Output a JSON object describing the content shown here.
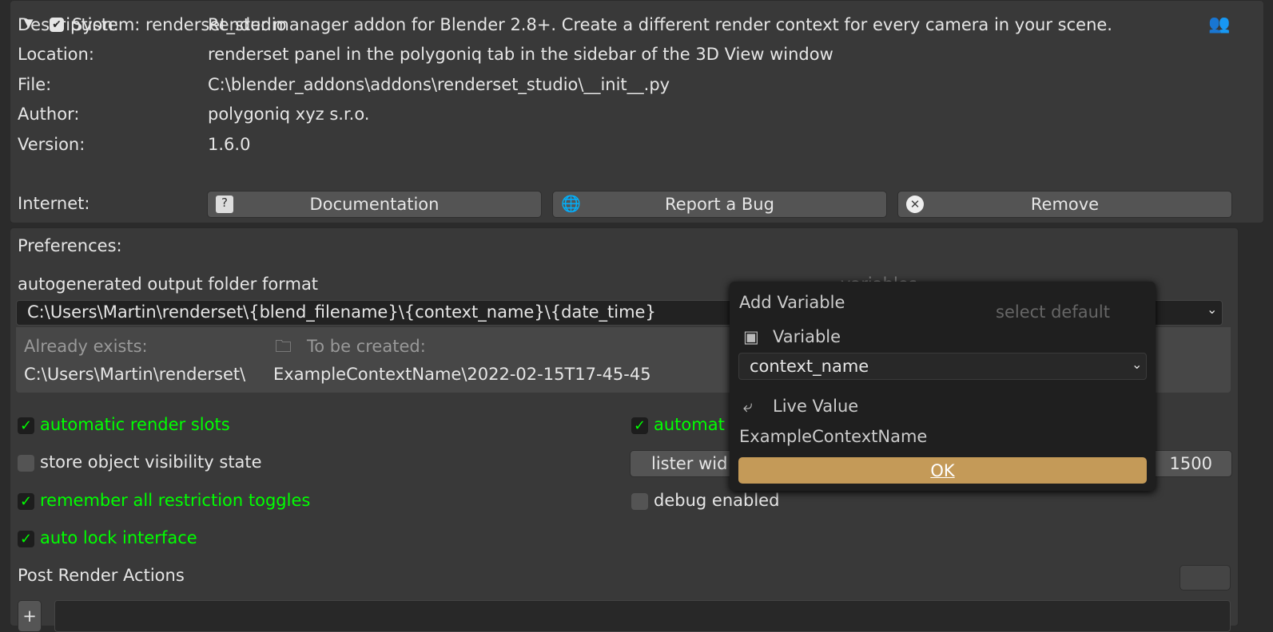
{
  "addon": {
    "title": "System: renderset_studio",
    "enabled": true,
    "rows": [
      {
        "label": "Description:",
        "value": "Render manager addon for Blender 2.8+. Create a different render context for every camera in your scene."
      },
      {
        "label": "Location:",
        "value": "renderset panel in the polygoniq tab in the sidebar of the 3D View window"
      },
      {
        "label": "File:",
        "value": "C:\\blender_addons\\addons\\renderset_studio\\__init__.py"
      },
      {
        "label": "Author:",
        "value": "polygoniq xyz s.r.o."
      },
      {
        "label": "Version:",
        "value": "1.6.0"
      }
    ],
    "internet_label": "Internet:",
    "buttons": {
      "documentation": "Documentation",
      "report_bug": "Report a Bug",
      "remove": "Remove"
    }
  },
  "preferences": {
    "heading": "Preferences:",
    "folder_format_label": "autogenerated output folder format",
    "variables_label": "variables",
    "folder_format_value": "C:\\Users\\Martin\\renderset\\{blend_filename}\\{context_name}\\{date_time}",
    "select_default": "select default",
    "already_exists_label": "Already exists:",
    "to_be_created_label": "To be created:",
    "already_exists_path": "C:\\Users\\Martin\\renderset\\",
    "to_be_created_path": "ExampleContextName\\2022-02-15T17-45-45",
    "options": [
      {
        "label": "automatic render slots",
        "checked": true
      },
      {
        "label": "store object visibility state",
        "checked": false
      },
      {
        "label": "remember all restriction toggles",
        "checked": true
      },
      {
        "label": "auto lock interface",
        "checked": true
      }
    ],
    "right_options": [
      {
        "label": "automat",
        "checked": true
      },
      {
        "label": "debug enabled",
        "checked": false
      }
    ],
    "lister_label": "lister wid",
    "lister_value": "1500",
    "post_render_label": "Post Render Actions"
  },
  "popup": {
    "title": "Add Variable",
    "variable_label": "Variable",
    "variable_value": "context_name",
    "live_value_label": "Live Value",
    "live_value": "ExampleContextName",
    "ok_label": "OK"
  },
  "colors": {
    "accent": "#c49a58",
    "checked_text": "#00ff00"
  }
}
